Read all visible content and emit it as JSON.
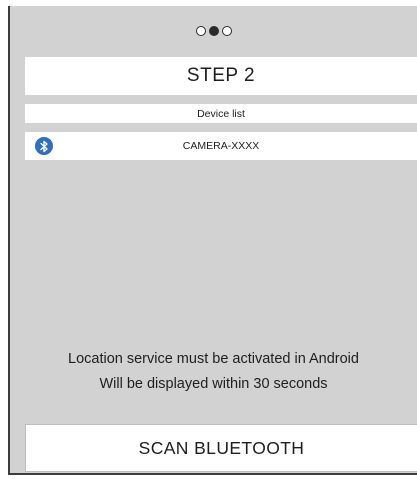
{
  "pager": {
    "total": 3,
    "active_index": 1
  },
  "step": {
    "title": "STEP 2"
  },
  "device_list": {
    "header": "Device list",
    "items": [
      {
        "name": "CAMERA-XXXX",
        "icon": "bluetooth-icon"
      }
    ]
  },
  "notice": {
    "line1": "Location service must be activated in Android",
    "line2": "Will be displayed within 30 seconds"
  },
  "scan_button": {
    "label": "SCAN BLUETOOTH"
  },
  "colors": {
    "background": "#d2d2d2",
    "panel": "#ffffff",
    "bluetooth": "#2f6fbe",
    "text": "#1e1e1e"
  }
}
